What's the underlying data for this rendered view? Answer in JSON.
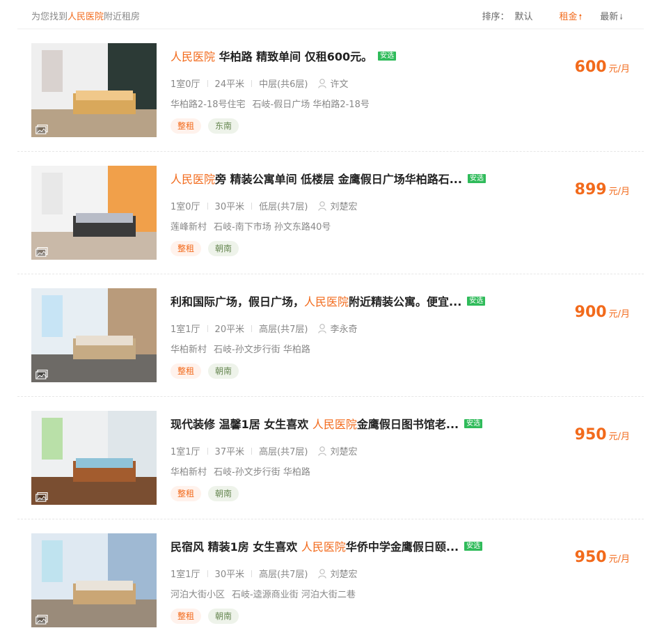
{
  "header": {
    "result_prefix": "为您找到",
    "result_keyword": "人民医院",
    "result_suffix": "附近租房",
    "sort_label": "排序：",
    "sort_default": "默认",
    "sort_rent": "租金",
    "sort_newest": "最新",
    "accent_color": "#f26a1b"
  },
  "listings": [
    {
      "title_prefix": "",
      "title_highlight": "人民医院",
      "title_suffix": " 华柏路 精致单间 仅租600元。",
      "badge": "安选",
      "layout": "1室0厅",
      "area": "24平米",
      "floor": "中层(共6层)",
      "agent": "许文",
      "community": "华柏路2-18号住宅",
      "location": "石岐-假日广场 华柏路2-18号",
      "tags": [
        "整租",
        "东南"
      ],
      "price": "600",
      "unit": "元/月"
    },
    {
      "title_prefix": "",
      "title_highlight": "人民医院",
      "title_suffix": "旁 精装公寓单间 低楼层 金鹰假日广场华柏路石...",
      "badge": "安选",
      "layout": "1室0厅",
      "area": "30平米",
      "floor": "低层(共7层)",
      "agent": "刘楚宏",
      "community": "莲峰新村",
      "location": "石岐-南下市场 孙文东路40号",
      "tags": [
        "整租",
        "朝南"
      ],
      "price": "899",
      "unit": "元/月"
    },
    {
      "title_prefix": "利和国际广场，假日广场，",
      "title_highlight": "人民医院",
      "title_suffix": "附近精装公寓。便宜...",
      "badge": "安选",
      "layout": "1室1厅",
      "area": "20平米",
      "floor": "高层(共7层)",
      "agent": "李永奇",
      "community": "华柏新村",
      "location": "石岐-孙文步行街 华柏路",
      "tags": [
        "整租",
        "朝南"
      ],
      "price": "900",
      "unit": "元/月"
    },
    {
      "title_prefix": "现代装修 温馨1居 女生喜欢 ",
      "title_highlight": "人民医院",
      "title_suffix": "金鹰假日图书馆老...",
      "badge": "安选",
      "layout": "1室1厅",
      "area": "37平米",
      "floor": "高层(共7层)",
      "agent": "刘楚宏",
      "community": "华柏新村",
      "location": "石岐-孙文步行街 华柏路",
      "tags": [
        "整租",
        "朝南"
      ],
      "price": "950",
      "unit": "元/月"
    },
    {
      "title_prefix": "民宿风 精装1房 女生喜欢 ",
      "title_highlight": "人民医院",
      "title_suffix": "华侨中学金鹰假日颐...",
      "badge": "安选",
      "layout": "1室1厅",
      "area": "30平米",
      "floor": "高层(共7层)",
      "agent": "刘楚宏",
      "community": "河泊大街小区",
      "location": "石岐-逵源商业街 河泊大街二巷",
      "tags": [
        "整租",
        "朝南"
      ],
      "price": "950",
      "unit": "元/月"
    }
  ]
}
